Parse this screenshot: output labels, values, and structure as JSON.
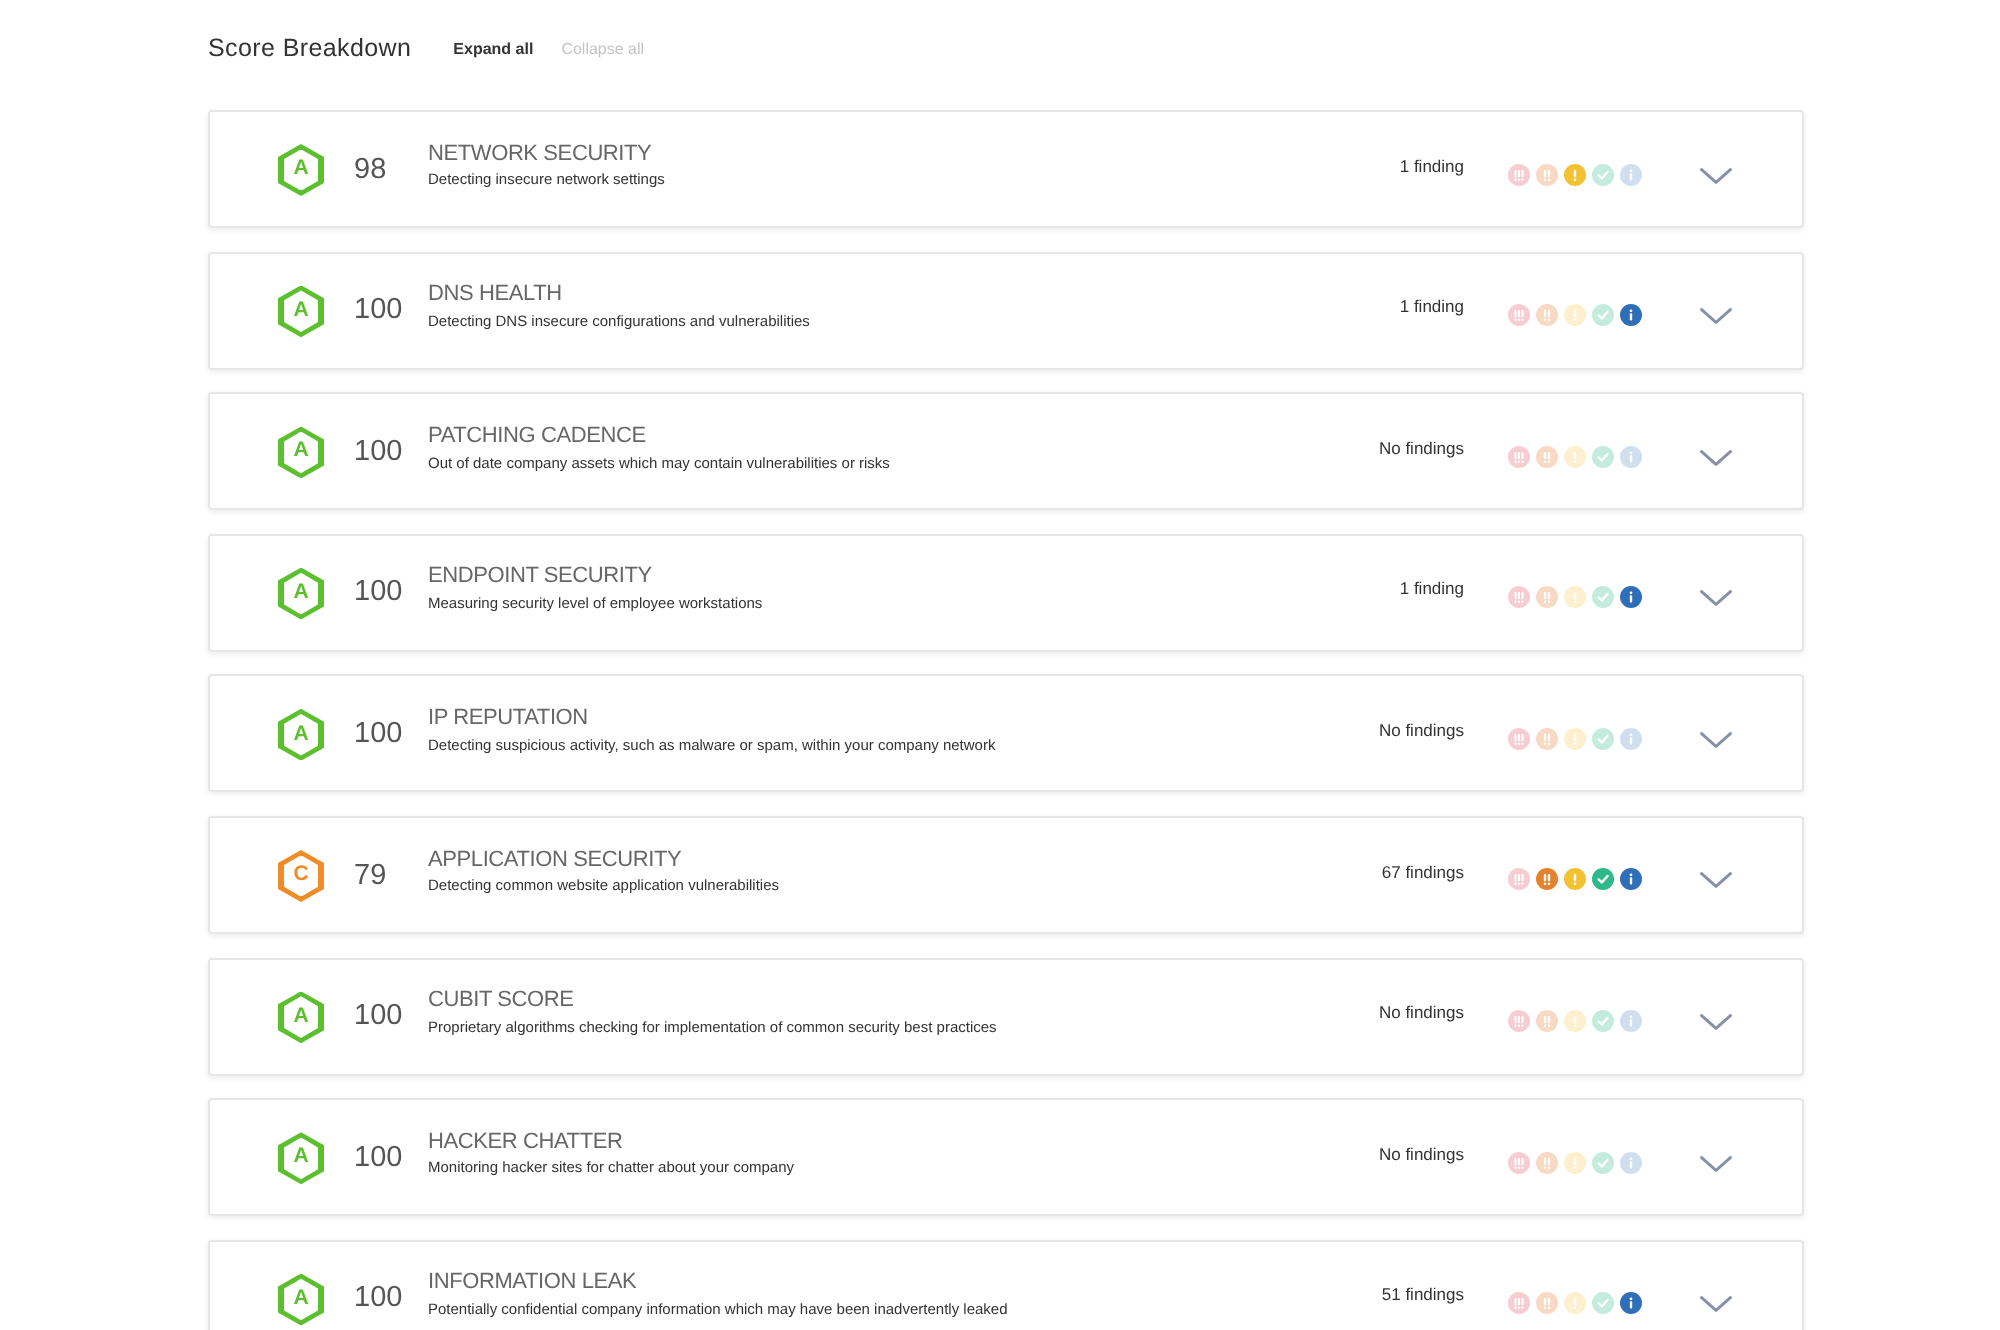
{
  "header": {
    "title": "Score Breakdown",
    "actions": [
      {
        "label": "Expand all",
        "disabled": false
      },
      {
        "label": "Collapse all",
        "disabled": true
      }
    ]
  },
  "rows": [
    {
      "grade": {
        "letter": "A",
        "color": "#5cbf2e"
      },
      "score": "98",
      "title": "NETWORK SECURITY",
      "description": "Detecting insecure network settings",
      "findings": "1 finding",
      "expanded": false,
      "severities": [
        {
          "kind": "critical",
          "color": "#f7ccd2"
        },
        {
          "kind": "high",
          "color": "#f8d9c3"
        },
        {
          "kind": "medium",
          "color": "#f3c233"
        },
        {
          "kind": "low",
          "color": "#c3ebde"
        },
        {
          "kind": "info",
          "color": "#cfdff0"
        }
      ]
    },
    {
      "grade": {
        "letter": "A",
        "color": "#5cbf2e"
      },
      "score": "100",
      "title": "DNS HEALTH",
      "description": "Detecting DNS insecure configurations and vulnerabilities",
      "findings": "1 finding",
      "expanded": false,
      "severities": [
        {
          "kind": "critical",
          "color": "#f7ccd2"
        },
        {
          "kind": "high",
          "color": "#f8d9c3"
        },
        {
          "kind": "medium",
          "color": "#fcf0cf"
        },
        {
          "kind": "low",
          "color": "#c3ebde"
        },
        {
          "kind": "info",
          "color": "#2e6fb7"
        }
      ]
    },
    {
      "grade": {
        "letter": "A",
        "color": "#5cbf2e"
      },
      "score": "100",
      "title": "PATCHING CADENCE",
      "description": "Out of date company assets which may contain vulnerabilities or risks",
      "findings": "No findings",
      "expanded": false,
      "severities": [
        {
          "kind": "critical",
          "color": "#f7ccd2"
        },
        {
          "kind": "high",
          "color": "#f8d9c3"
        },
        {
          "kind": "medium",
          "color": "#fcf0cf"
        },
        {
          "kind": "low",
          "color": "#c3ebde"
        },
        {
          "kind": "info",
          "color": "#cfdff0"
        }
      ]
    },
    {
      "grade": {
        "letter": "A",
        "color": "#5cbf2e"
      },
      "score": "100",
      "title": "ENDPOINT SECURITY",
      "description": "Measuring security level of employee workstations",
      "findings": "1 finding",
      "expanded": false,
      "severities": [
        {
          "kind": "critical",
          "color": "#f7ccd2"
        },
        {
          "kind": "high",
          "color": "#f8d9c3"
        },
        {
          "kind": "medium",
          "color": "#fcf0cf"
        },
        {
          "kind": "low",
          "color": "#c3ebde"
        },
        {
          "kind": "info",
          "color": "#2e6fb7"
        }
      ]
    },
    {
      "grade": {
        "letter": "A",
        "color": "#5cbf2e"
      },
      "score": "100",
      "title": "IP REPUTATION",
      "description": "Detecting suspicious activity, such as malware or spam, within your company network",
      "findings": "No findings",
      "expanded": false,
      "severities": [
        {
          "kind": "critical",
          "color": "#f7ccd2"
        },
        {
          "kind": "high",
          "color": "#f8d9c3"
        },
        {
          "kind": "medium",
          "color": "#fcf0cf"
        },
        {
          "kind": "low",
          "color": "#c3ebde"
        },
        {
          "kind": "info",
          "color": "#cfdff0"
        }
      ]
    },
    {
      "grade": {
        "letter": "C",
        "color": "#f08c28"
      },
      "score": "79",
      "title": "APPLICATION SECURITY",
      "description": "Detecting common website application vulnerabilities",
      "findings": "67 findings",
      "expanded": false,
      "severities": [
        {
          "kind": "critical",
          "color": "#f7ccd2"
        },
        {
          "kind": "high",
          "color": "#e5822f"
        },
        {
          "kind": "medium",
          "color": "#f3c233"
        },
        {
          "kind": "low",
          "color": "#2fb88a"
        },
        {
          "kind": "info",
          "color": "#2e6fb7"
        }
      ]
    },
    {
      "grade": {
        "letter": "A",
        "color": "#5cbf2e"
      },
      "score": "100",
      "title": "CUBIT SCORE",
      "description": "Proprietary algorithms checking for implementation of common security best practices",
      "findings": "No findings",
      "expanded": false,
      "severities": [
        {
          "kind": "critical",
          "color": "#f7ccd2"
        },
        {
          "kind": "high",
          "color": "#f8d9c3"
        },
        {
          "kind": "medium",
          "color": "#fcf0cf"
        },
        {
          "kind": "low",
          "color": "#c3ebde"
        },
        {
          "kind": "info",
          "color": "#cfdff0"
        }
      ]
    },
    {
      "grade": {
        "letter": "A",
        "color": "#5cbf2e"
      },
      "score": "100",
      "title": "HACKER CHATTER",
      "description": "Monitoring hacker sites for chatter about your company",
      "findings": "No findings",
      "expanded": false,
      "severities": [
        {
          "kind": "critical",
          "color": "#f7ccd2"
        },
        {
          "kind": "high",
          "color": "#f8d9c3"
        },
        {
          "kind": "medium",
          "color": "#fcf0cf"
        },
        {
          "kind": "low",
          "color": "#c3ebde"
        },
        {
          "kind": "info",
          "color": "#cfdff0"
        }
      ]
    },
    {
      "grade": {
        "letter": "A",
        "color": "#5cbf2e"
      },
      "score": "100",
      "title": "INFORMATION LEAK",
      "description": "Potentially confidential company information which may have been inadvertently leaked",
      "findings": "51 findings",
      "expanded": false,
      "severities": [
        {
          "kind": "critical",
          "color": "#f7ccd2"
        },
        {
          "kind": "high",
          "color": "#f8d9c3"
        },
        {
          "kind": "medium",
          "color": "#fcf0cf"
        },
        {
          "kind": "low",
          "color": "#c3ebde"
        },
        {
          "kind": "info",
          "color": "#2e6fb7"
        }
      ]
    }
  ]
}
